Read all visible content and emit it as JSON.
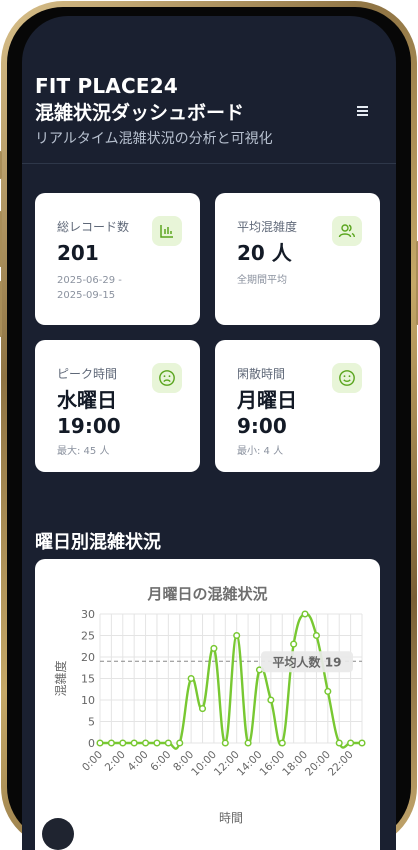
{
  "header": {
    "title_line1": "FIT PLACE24",
    "title_line2": "混雑状況ダッシュボード",
    "subtitle": "リアルタイム混雑状況の分析と可視化",
    "menu_icon": "hamburger-menu-icon"
  },
  "cards": [
    {
      "label": "総レコード数",
      "value": "201",
      "sub_line1": "2025-06-29 -",
      "sub_line2": "2025-09-15",
      "icon": "bar-chart-icon"
    },
    {
      "label": "平均混雑度",
      "value": "20 人",
      "sub_line1": "全期間平均",
      "icon": "users-icon"
    },
    {
      "label": "ピーク時間",
      "value_line1": "水曜日",
      "value_line2": "19:00",
      "sub_line1": "最大: 45 人",
      "icon": "frown-icon"
    },
    {
      "label": "閑散時間",
      "value_line1": "月曜日",
      "value_line2": "9:00",
      "sub_line1": "最小: 4 人",
      "icon": "smile-icon"
    }
  ],
  "section_title": "曜日別混雑状況",
  "colors": {
    "accent_green": "#78c832",
    "icon_bg": "#e8f5d8",
    "background": "#1a2030"
  },
  "chart_data": {
    "type": "line",
    "title": "月曜日の混雑状況",
    "xlabel": "時間",
    "ylabel": "混雑度",
    "ylim": [
      0,
      30
    ],
    "yticks": [
      0,
      5,
      10,
      15,
      20,
      25,
      30
    ],
    "x_tick_labels": [
      "0:00",
      "2:00",
      "4:00",
      "6:00",
      "8:00",
      "10:00",
      "12:00",
      "14:00",
      "16:00",
      "18:00",
      "20:00",
      "22:00"
    ],
    "x": [
      0,
      1,
      2,
      3,
      4,
      5,
      6,
      7,
      8,
      9,
      10,
      11,
      12,
      13,
      14,
      15,
      16,
      17,
      18,
      19,
      20,
      21,
      22,
      23
    ],
    "series": [
      {
        "values": [
          0,
          0,
          0,
          0,
          0,
          0,
          0,
          0,
          15,
          8,
          22,
          0,
          25,
          0,
          17,
          10,
          0,
          23,
          30,
          25,
          12,
          0,
          0,
          0
        ]
      }
    ],
    "average_line": {
      "value": 19,
      "label": "平均人数 19"
    },
    "grid": true,
    "line_color": "#78c832"
  }
}
